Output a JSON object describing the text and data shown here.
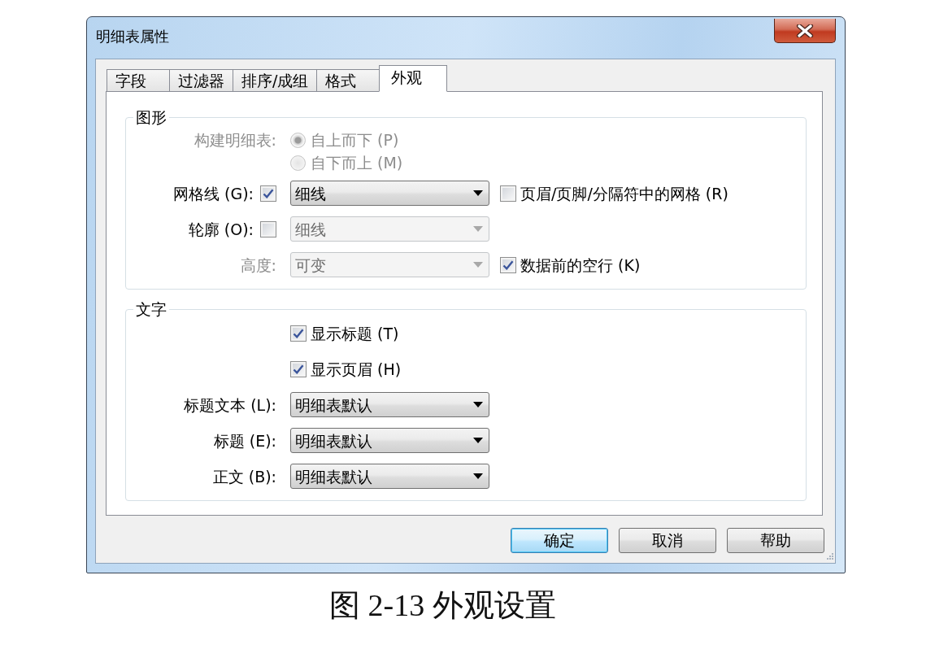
{
  "window": {
    "title": "明细表属性"
  },
  "tabs": [
    {
      "label": "字段",
      "selected": false
    },
    {
      "label": "过滤器",
      "selected": false
    },
    {
      "label": "排序/成组",
      "selected": false
    },
    {
      "label": "格式",
      "selected": false
    },
    {
      "label": "外观",
      "selected": true
    }
  ],
  "groups": [
    {
      "title": "图形",
      "rows": [
        {
          "kind": "radio",
          "label": "构建明细表:",
          "disabled": true,
          "options": [
            {
              "label": "自上而下 (P)",
              "selected": true
            },
            {
              "label": "自下而上 (M)",
              "selected": false
            }
          ]
        },
        {
          "kind": "check-dropdown",
          "label": "网格线 (G):",
          "disabled": false,
          "checked": true,
          "dropdown": {
            "value": "细线",
            "disabled": false
          },
          "side_check": {
            "label": "页眉/页脚/分隔符中的网格 (R)",
            "checked": false
          }
        },
        {
          "kind": "check-dropdown",
          "label": "轮廓 (O):",
          "disabled": false,
          "checked": false,
          "dropdown": {
            "value": "细线",
            "disabled": true
          }
        },
        {
          "kind": "dropdown",
          "label": "高度:",
          "disabled": true,
          "dropdown": {
            "value": "可变",
            "disabled": true
          },
          "side_check": {
            "label": "数据前的空行 (K)",
            "checked": true
          }
        }
      ]
    },
    {
      "title": "文字",
      "rows": [
        {
          "kind": "checkbox",
          "label": "显示标题 (T)",
          "disabled": false,
          "checked": true
        },
        {
          "kind": "checkbox",
          "label": "显示页眉 (H)",
          "disabled": false,
          "checked": true
        },
        {
          "kind": "dropdown",
          "label": "标题文本 (L):",
          "disabled": false,
          "dropdown": {
            "value": "明细表默认",
            "disabled": false
          }
        },
        {
          "kind": "dropdown",
          "label": "标题 (E):",
          "disabled": false,
          "dropdown": {
            "value": "明细表默认",
            "disabled": false
          }
        },
        {
          "kind": "dropdown",
          "label": "正文 (B):",
          "disabled": false,
          "dropdown": {
            "value": "明细表默认",
            "disabled": false
          }
        }
      ]
    }
  ],
  "buttons": [
    {
      "label": "确定",
      "default": true
    },
    {
      "label": "取消",
      "default": false
    },
    {
      "label": "帮助",
      "default": false
    }
  ],
  "caption": "图 2-13 外观设置"
}
